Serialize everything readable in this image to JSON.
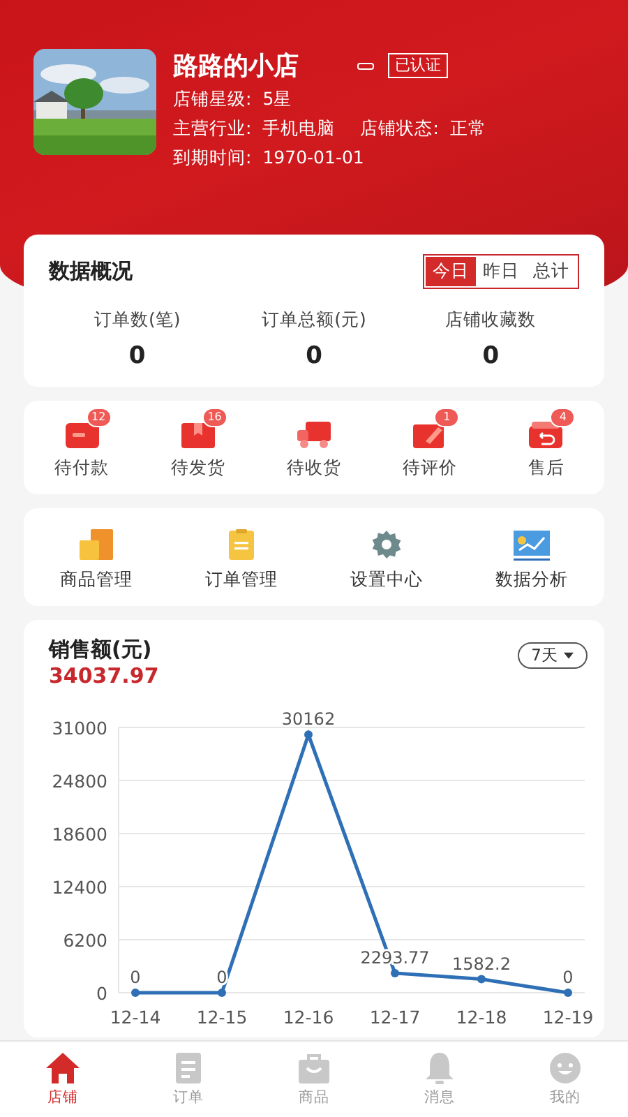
{
  "shop": {
    "name": "路路的小店",
    "verified": "已认证",
    "info": [
      {
        "label": "店铺星级:",
        "value": "5星"
      },
      {
        "label": "主营行业:",
        "value": "手机电脑"
      },
      {
        "label": "店铺状态:",
        "value": "正常"
      },
      {
        "label": "到期时间:",
        "value": "1970-01-01"
      }
    ]
  },
  "overview": {
    "title": "数据概况",
    "tabs": [
      {
        "label": "今日",
        "selected": true
      },
      {
        "label": "昨日",
        "selected": false
      },
      {
        "label": "总计",
        "selected": false
      }
    ],
    "stats": [
      {
        "label": "订单数(笔)",
        "value": "0"
      },
      {
        "label": "订单总额(元)",
        "value": "0"
      },
      {
        "label": "店铺收藏数",
        "value": "0"
      }
    ]
  },
  "orders": [
    {
      "label": "待付款",
      "badge": "12",
      "kind": "wallet"
    },
    {
      "label": "待发货",
      "badge": "16",
      "kind": "box"
    },
    {
      "label": "待收货",
      "kind": "truck"
    },
    {
      "label": "待评价",
      "badge": "1",
      "kind": "pen"
    },
    {
      "label": "售后",
      "badge": "4",
      "kind": "return"
    }
  ],
  "tools": [
    {
      "label": "商品管理",
      "kind": "boxes"
    },
    {
      "label": "订单管理",
      "kind": "clipboard"
    },
    {
      "label": "设置中心",
      "kind": "gear"
    },
    {
      "label": "数据分析",
      "kind": "chart"
    }
  ],
  "sales": {
    "title": "销售额(元)",
    "total": "34037.97",
    "range": "7天",
    "chart_data": {
      "type": "line",
      "categories": [
        "12-14",
        "12-15",
        "12-16",
        "12-17",
        "12-18",
        "12-19"
      ],
      "series": [
        {
          "color": "#2f6fb5",
          "marker": true,
          "values": [
            0,
            0,
            30162,
            2293.77,
            1582.2,
            0
          ]
        }
      ],
      "ylim": [
        0,
        31000
      ],
      "yticks": [
        0,
        6200,
        12400,
        18600,
        24800,
        31000
      ],
      "grid": true,
      "data_labels": true
    }
  },
  "nav": [
    {
      "label": "店铺",
      "kind": "home",
      "selected": true
    },
    {
      "label": "订单",
      "kind": "list",
      "selected": false
    },
    {
      "label": "商品",
      "kind": "bag",
      "selected": false
    },
    {
      "label": "消息",
      "kind": "bell",
      "selected": false
    },
    {
      "label": "我的",
      "kind": "face",
      "selected": false
    }
  ]
}
